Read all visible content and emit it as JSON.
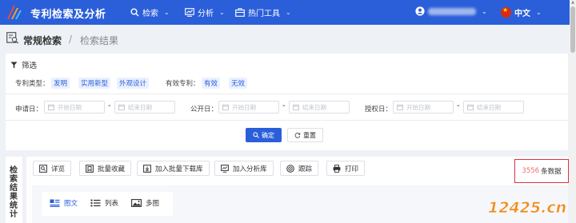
{
  "header": {
    "app_title": "专利检索及分析",
    "nav": [
      {
        "label": "检索",
        "icon": "search-icon"
      },
      {
        "label": "分析",
        "icon": "chart-icon"
      },
      {
        "label": "热门工具",
        "icon": "toolbox-icon"
      }
    ],
    "user_icon": "user-icon",
    "language": "中文",
    "brand_color": "#2b5fd9"
  },
  "breadcrumb": {
    "items": [
      "常规检索",
      "检索结果"
    ],
    "separator": "/"
  },
  "filter": {
    "title": "筛选",
    "type_label": "专利类型：",
    "type_options": [
      "发明",
      "实用新型",
      "外观设计"
    ],
    "valid_label": "有效专利：",
    "valid_options": [
      "有效",
      "无效"
    ],
    "date_fields": [
      {
        "label": "申请日：",
        "start_placeholder": "开始日期",
        "end_placeholder": "结束日期"
      },
      {
        "label": "公开日：",
        "start_placeholder": "开始日期",
        "end_placeholder": "结束日期"
      },
      {
        "label": "授权日：",
        "start_placeholder": "开始日期",
        "end_placeholder": "结束日期"
      }
    ],
    "range_separator": "-",
    "confirm_label": "确定",
    "reset_label": "重置"
  },
  "side_panel": {
    "title": "检索结果统计"
  },
  "toolbar": {
    "buttons": [
      {
        "label": "详览",
        "icon": "detail-icon"
      },
      {
        "label": "批量收藏",
        "icon": "bookmark-icon"
      },
      {
        "label": "加入批量下载库",
        "icon": "download-icon"
      },
      {
        "label": "加入分析库",
        "icon": "analysis-icon"
      },
      {
        "label": "跟踪",
        "icon": "track-icon"
      },
      {
        "label": "打印",
        "icon": "print-icon"
      }
    ]
  },
  "results": {
    "count": "3556",
    "count_unit": "条数据",
    "count_color": "#f56c6c",
    "highlight_color": "#e0303d"
  },
  "view_tabs": [
    {
      "label": "图文",
      "icon": "image-text-icon",
      "active": true
    },
    {
      "label": "列表",
      "icon": "list-icon",
      "active": false
    },
    {
      "label": "多图",
      "icon": "multi-image-icon",
      "active": false
    }
  ],
  "watermark": {
    "text": "12425.cn"
  }
}
